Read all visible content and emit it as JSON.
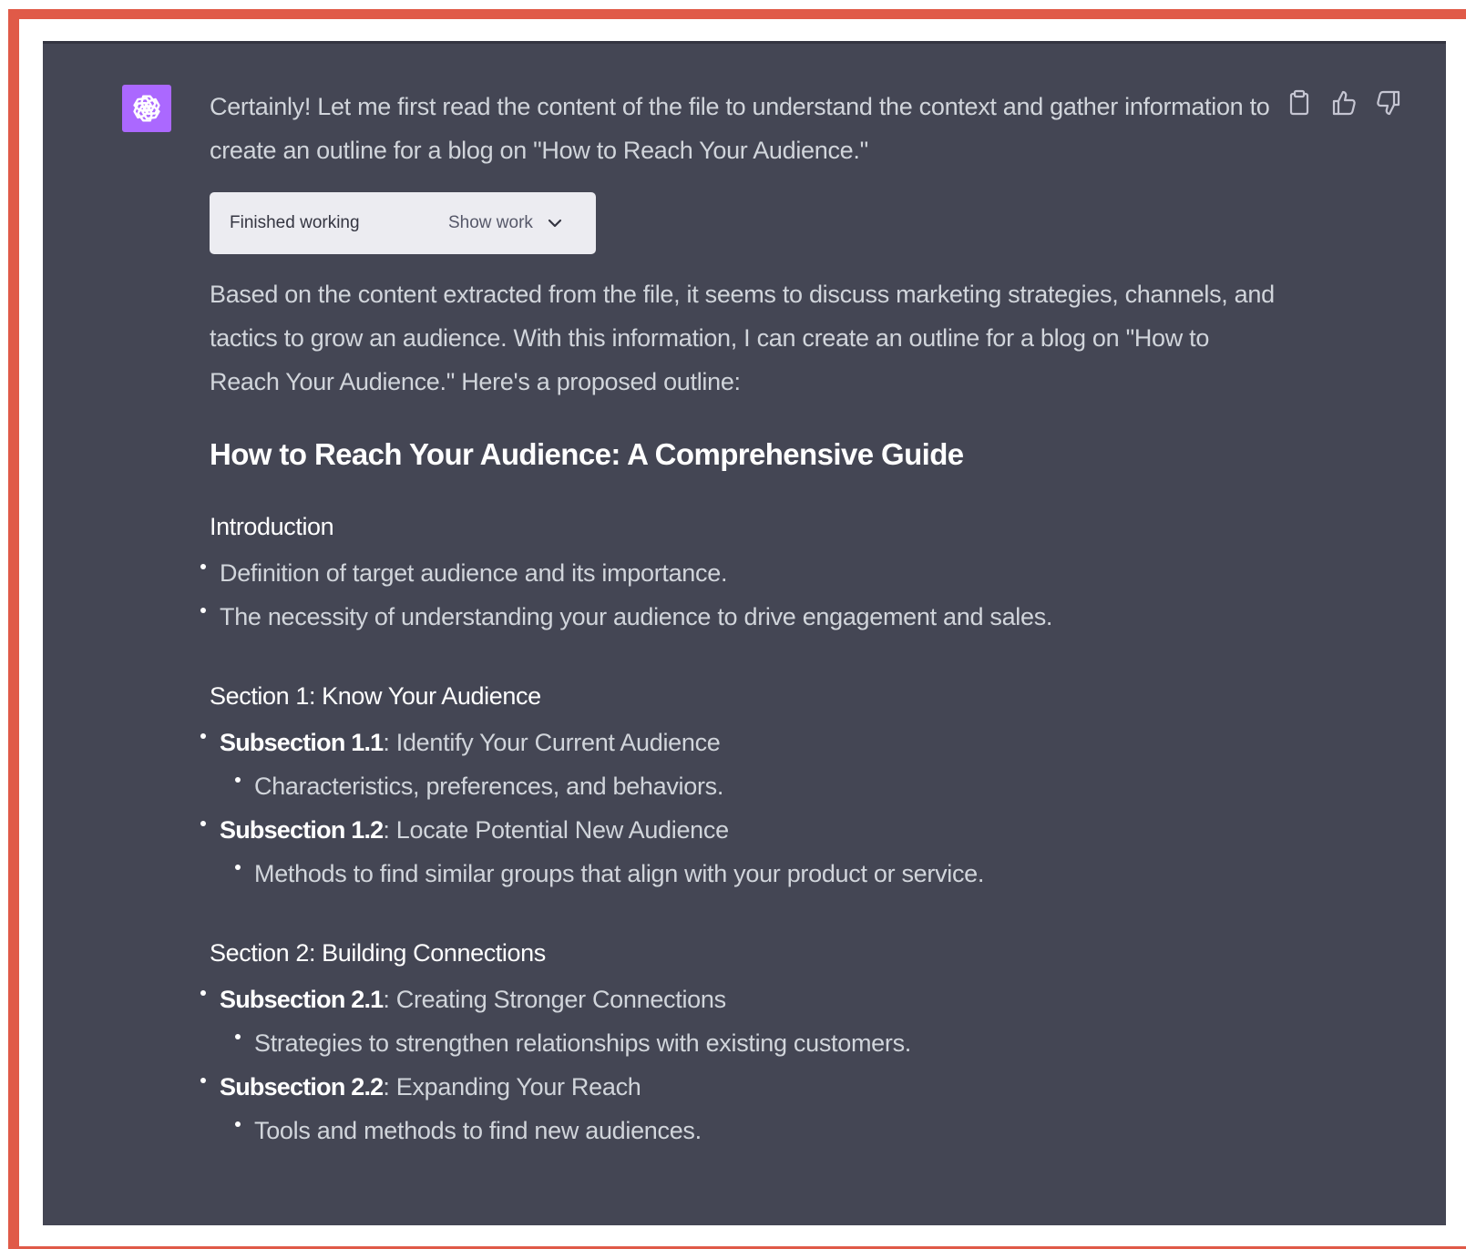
{
  "message": {
    "intro": "Certainly! Let me first read the content of the file to understand the context and gather information to create an outline for a blog on \"How to Reach Your Audience.\"",
    "work_box": {
      "status": "Finished working",
      "toggle_label": "Show work"
    },
    "summary": "Based on the content extracted from the file, it seems to discuss marketing strategies, channels, and tactics to grow an audience. With this information, I can create an outline for a blog on \"How to Reach Your Audience.\" Here's a proposed outline:",
    "heading": "How to Reach Your Audience: A Comprehensive Guide",
    "introduction": {
      "title": "Introduction",
      "bullets": [
        "Definition of target audience and its importance.",
        "The necessity of understanding your audience to drive engagement and sales."
      ]
    },
    "sections": [
      {
        "title": "Section 1: Know Your Audience",
        "subsections": [
          {
            "label": "Subsection 1.1",
            "text": ": Identify Your Current Audience",
            "detail": "Characteristics, preferences, and behaviors."
          },
          {
            "label": "Subsection 1.2",
            "text": ": Locate Potential New Audience",
            "detail": "Methods to find similar groups that align with your product or service."
          }
        ]
      },
      {
        "title": "Section 2: Building Connections",
        "subsections": [
          {
            "label": "Subsection 2.1",
            "text": ": Creating Stronger Connections",
            "detail": "Strategies to strengthen relationships with existing customers."
          },
          {
            "label": "Subsection 2.2",
            "text": ": Expanding Your Reach",
            "detail": "Tools and methods to find new audiences."
          }
        ]
      }
    ]
  },
  "icons": {
    "avatar": "openai-logo-icon",
    "copy": "clipboard-icon",
    "like": "thumbs-up-icon",
    "dislike": "thumbs-down-icon",
    "expand": "chevron-down-icon"
  },
  "colors": {
    "frame_border": "#e05a48",
    "chat_background": "#444654",
    "avatar_background": "#ab68ff",
    "text": "#d1d5db",
    "heading_text": "#ffffff",
    "work_box_background": "#ececf1"
  }
}
